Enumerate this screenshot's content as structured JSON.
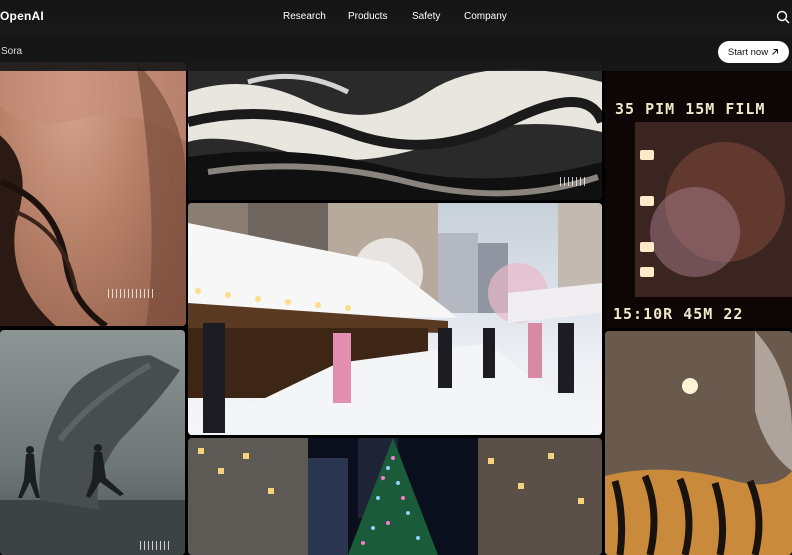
{
  "header": {
    "logo": "OpenAI",
    "nav": [
      "Research",
      "Products",
      "Safety",
      "Company"
    ],
    "search_icon": "search-icon"
  },
  "subheader": {
    "section_title": "Sora",
    "cta_label": "Start now",
    "cta_icon": "arrow-up-right-icon"
  },
  "tiles": {
    "film_top_text": "35 PIM 15ḾM FILM",
    "film_top_text_clean": "35 PIM 15M FILM",
    "film_bottom_text": "15:10R 45ḾM 22ᵀᴹ",
    "film_bottom_text_clean": "15:10R 45M 22"
  },
  "colors": {
    "header_bg": "#161616",
    "accent": "#ffffff"
  }
}
